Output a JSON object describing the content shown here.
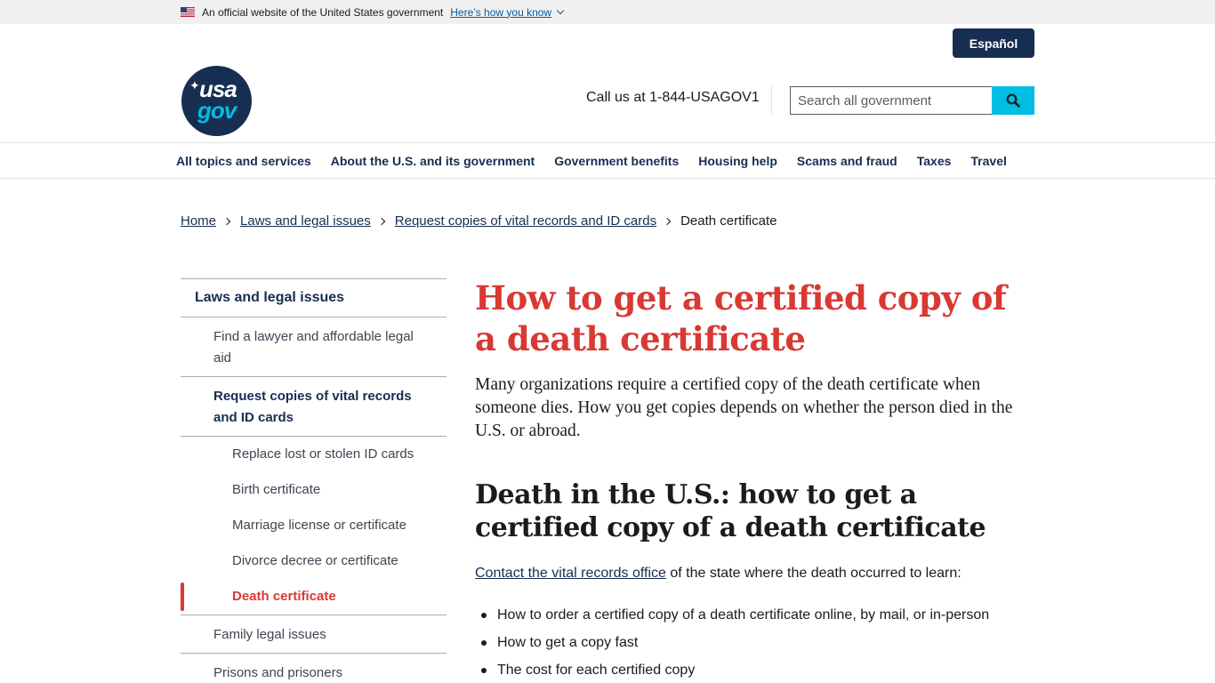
{
  "banner": {
    "text": "An official website of the United States government",
    "link": "Here’s how you know"
  },
  "header": {
    "lang_button": "Español",
    "logo_line1": "usa",
    "logo_line2": "gov",
    "call": "Call us at 1-844-USAGOV1",
    "search_placeholder": "Search all government",
    "search_icon": "search-icon"
  },
  "nav": {
    "items": [
      "All topics and services",
      "About the U.S. and its government",
      "Government benefits",
      "Housing help",
      "Scams and fraud",
      "Taxes",
      "Travel"
    ]
  },
  "breadcrumb": {
    "items": [
      "Home",
      "Laws and legal issues",
      "Request copies of vital records and ID cards"
    ],
    "current": "Death certificate"
  },
  "sidenav": {
    "top": "Laws and legal issues",
    "lvl2_a": "Find a lawyer and affordable legal aid",
    "lvl2_b": "Request copies of vital records and ID cards",
    "sub": [
      "Replace lost or stolen ID cards",
      "Birth certificate",
      "Marriage license or certificate",
      "Divorce decree or certificate",
      "Death certificate"
    ],
    "lvl2_c": "Family legal issues",
    "lvl2_d": "Prisons and prisoners"
  },
  "main": {
    "title": "How to get a certified copy of a death certificate",
    "lead": "Many organizations require a certified copy of the death certificate when someone dies. How you get copies depends on whether the person died in the U.S. or abroad.",
    "h2": "Death in the U.S.: how to get a certified copy of a death certificate",
    "para_link": "Contact the vital records office",
    "para_rest": " of the state where the death occurred to learn:",
    "bullets": [
      "How to order a certified copy of a death certificate online, by mail, or in-person",
      "How to get a copy fast",
      "The cost for each certified copy"
    ]
  },
  "colors": {
    "navy": "#162e51",
    "red": "#d83933",
    "cyan": "#00bde3"
  }
}
